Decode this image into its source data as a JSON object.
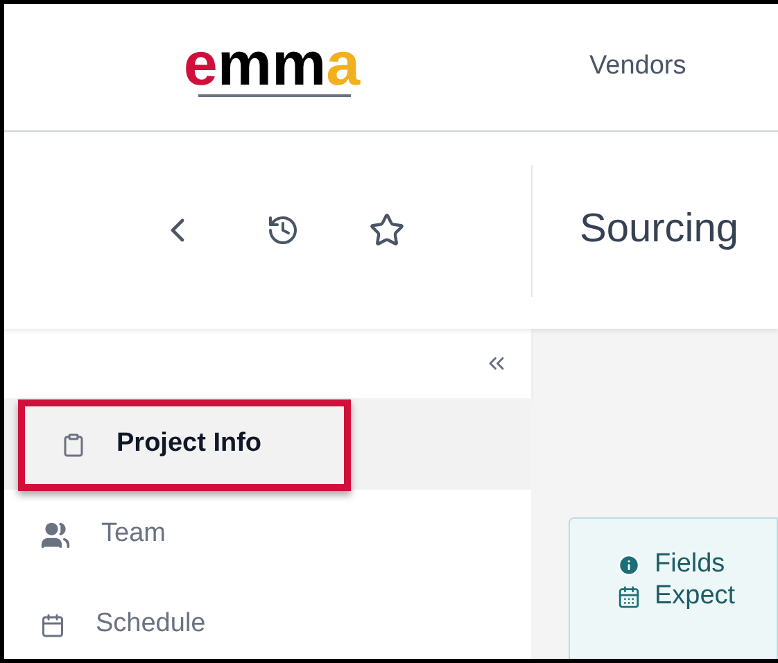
{
  "header": {
    "logo": {
      "letters": [
        "e",
        "mm",
        "a"
      ]
    },
    "nav": [
      {
        "label": "Vendors",
        "selected": false
      }
    ]
  },
  "toolbar": {
    "page_title": "Sourcing"
  },
  "sidebar": {
    "items": [
      {
        "kind": "clipboard",
        "label": "Project Info",
        "selected": true,
        "highlighted": true
      },
      {
        "kind": "team",
        "label": "Team",
        "selected": false,
        "highlighted": false
      },
      {
        "kind": "calendar",
        "label": "Schedule",
        "selected": false,
        "highlighted": false
      }
    ]
  },
  "notice": {
    "lines": [
      {
        "kind": "info",
        "text": "Fields"
      },
      {
        "kind": "calendar",
        "text": "Expect"
      }
    ]
  }
}
